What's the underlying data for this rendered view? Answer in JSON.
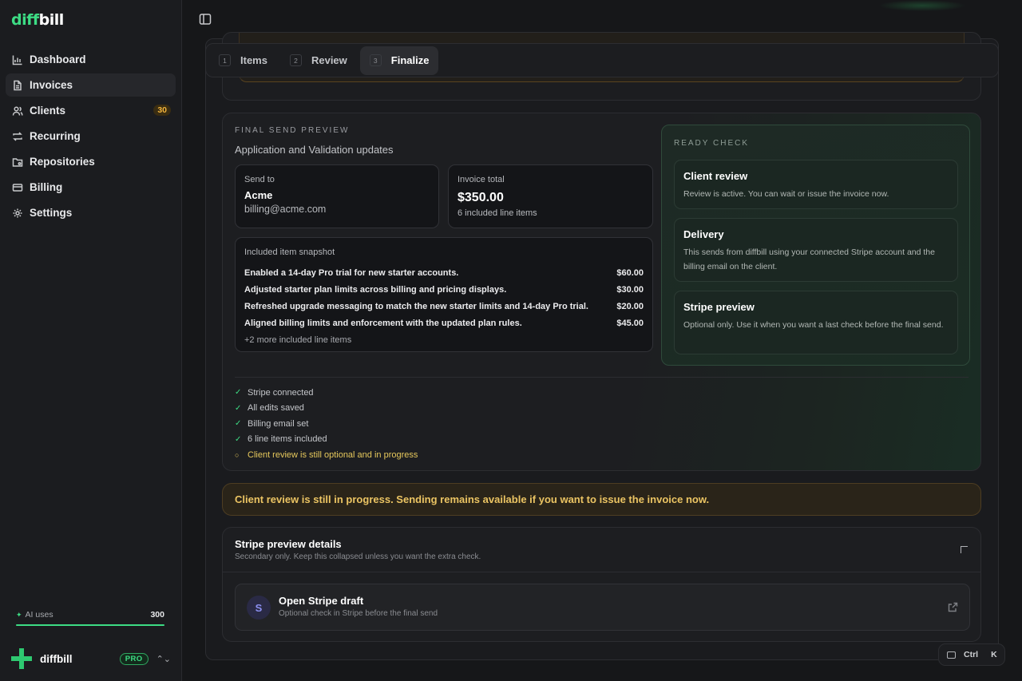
{
  "app": {
    "logo_part1": "diff",
    "logo_part2": "bill"
  },
  "sidebar": {
    "items": [
      {
        "label": "Dashboard",
        "icon": "chart-icon"
      },
      {
        "label": "Invoices",
        "icon": "document-icon",
        "active": true
      },
      {
        "label": "Clients",
        "icon": "users-icon",
        "badge": "30"
      },
      {
        "label": "Recurring",
        "icon": "repeat-icon"
      },
      {
        "label": "Repositories",
        "icon": "folder-git-icon"
      },
      {
        "label": "Billing",
        "icon": "card-icon"
      },
      {
        "label": "Settings",
        "icon": "gear-icon"
      }
    ],
    "ai_uses": {
      "label": "AI uses",
      "value": "300",
      "fill_fraction": 1.0
    },
    "account": {
      "name": "diffbill",
      "plan": "PRO"
    }
  },
  "steps": [
    {
      "num": "1",
      "label": "Items"
    },
    {
      "num": "2",
      "label": "Review"
    },
    {
      "num": "3",
      "label": "Finalize",
      "active": true
    }
  ],
  "final_send": {
    "eyebrow": "FINAL SEND PREVIEW",
    "subtitle": "Application and Validation updates",
    "send_to": {
      "label": "Send to",
      "name": "Acme",
      "email": "billing@acme.com"
    },
    "invoice_total": {
      "label": "Invoice total",
      "amount": "$350.00",
      "items_note": "6 included line items"
    },
    "snapshot": {
      "label": "Included item snapshot",
      "rows": [
        {
          "desc": "Enabled a 14-day Pro trial for new starter accounts.",
          "amount": "$60.00"
        },
        {
          "desc": "Adjusted starter plan limits across billing and pricing displays.",
          "amount": "$30.00"
        },
        {
          "desc": "Refreshed upgrade messaging to match the new starter limits and 14-day Pro trial.",
          "amount": "$20.00"
        },
        {
          "desc": "Aligned billing limits and enforcement with the updated plan rules.",
          "amount": "$45.00"
        }
      ],
      "more": "+2 more included line items"
    },
    "ready_check": {
      "eyebrow": "READY CHECK",
      "cards": [
        {
          "title": "Client review",
          "desc": "Review is active. You can wait or issue the invoice now."
        },
        {
          "title": "Delivery",
          "desc": "This sends from diffbill using your connected Stripe account and the billing email on the client."
        },
        {
          "title": "Stripe preview",
          "desc": "Optional only. Use it when you want a last check before the final send."
        }
      ]
    },
    "checks": [
      {
        "mark": "✓",
        "text": "Stripe connected"
      },
      {
        "mark": "✓",
        "text": "All edits saved"
      },
      {
        "mark": "✓",
        "text": "Billing email set"
      },
      {
        "mark": "✓",
        "text": "6 line items included"
      },
      {
        "mark": "○",
        "text": "Client review is still optional and in progress",
        "warn": true
      }
    ]
  },
  "alert": "Client review is still in progress. Sending remains available if you want to issue the invoice now.",
  "stripe_details": {
    "title": "Stripe preview details",
    "subtitle": "Secondary only. Keep this collapsed unless you want the extra check.",
    "draft": {
      "badge": "S",
      "title": "Open Stripe draft",
      "desc": "Optional check in Stripe before the final send"
    }
  },
  "shortcut": {
    "key1": "Ctrl",
    "key2": "K"
  }
}
